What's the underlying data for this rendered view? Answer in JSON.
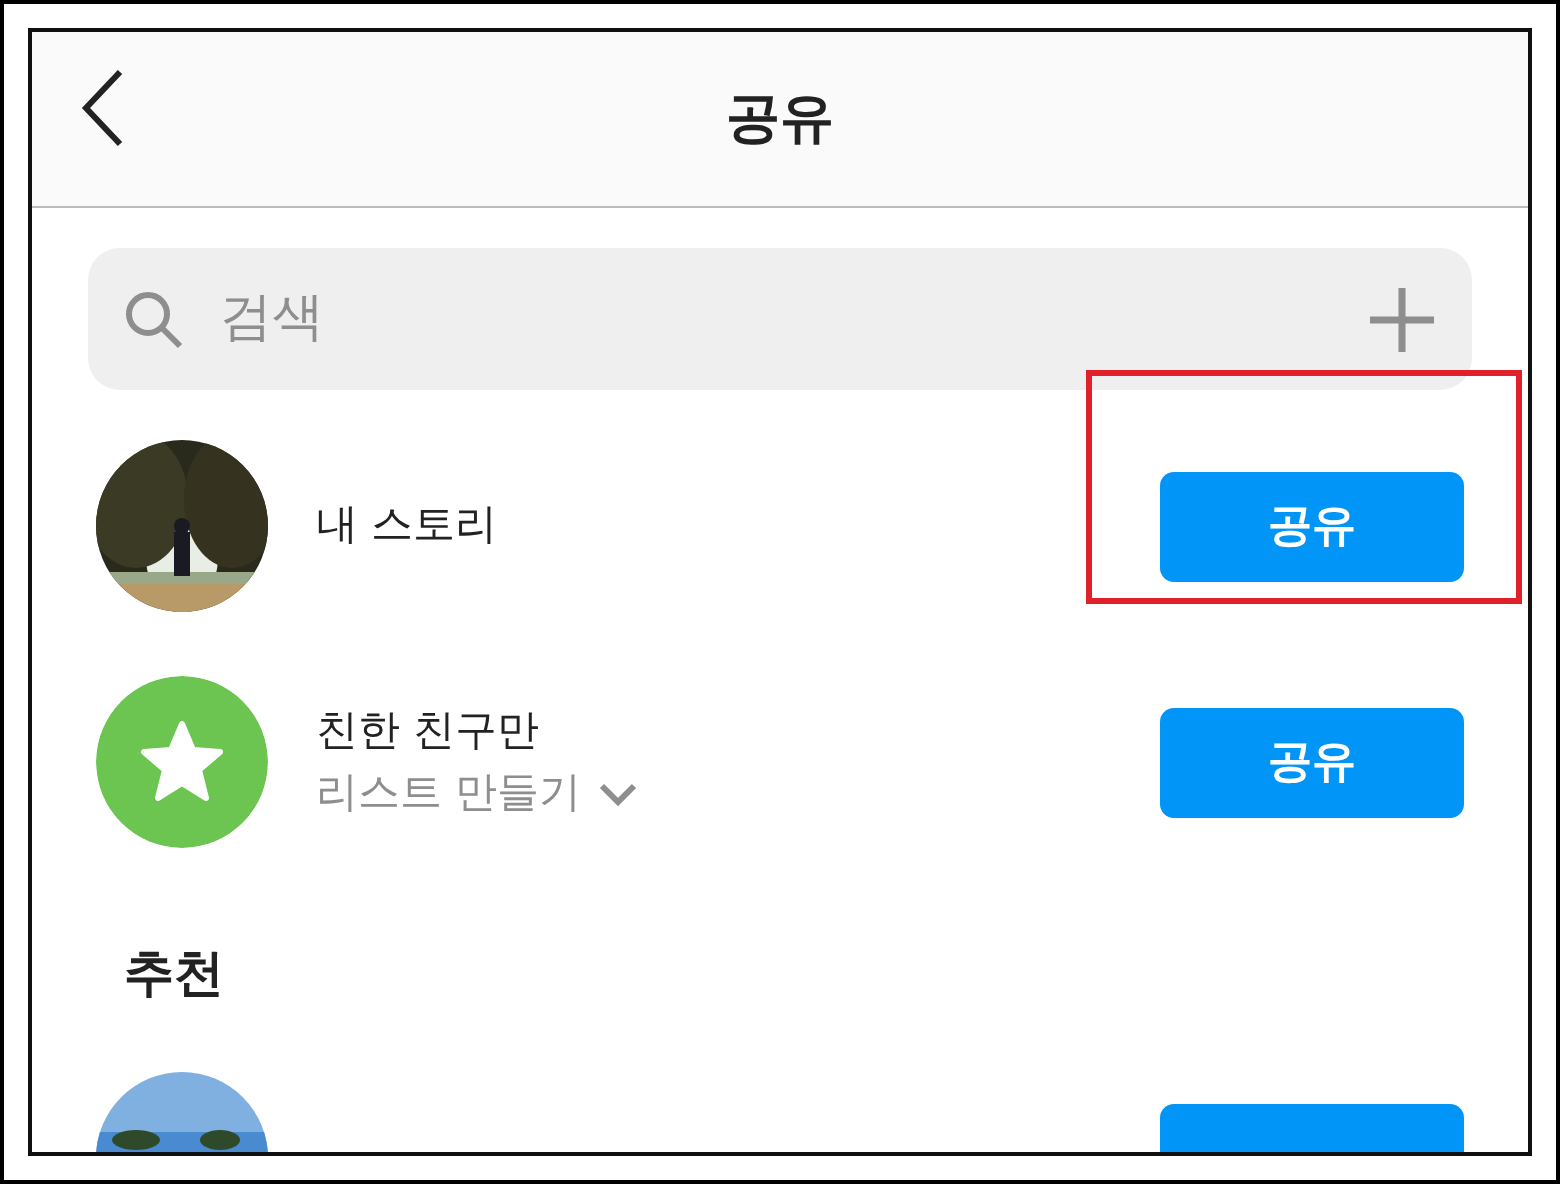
{
  "header": {
    "title": "공유"
  },
  "search": {
    "placeholder": "검색"
  },
  "rows": [
    {
      "kind": "story",
      "name": "내 스토리",
      "button": "공유",
      "highlighted": true
    },
    {
      "kind": "close_friends",
      "name": "친한 친구만",
      "subtitle": "리스트 만들기",
      "button": "공유",
      "highlighted": false
    }
  ],
  "suggested": {
    "heading": "추천",
    "rows": [
      {
        "kind": "partial"
      }
    ]
  }
}
